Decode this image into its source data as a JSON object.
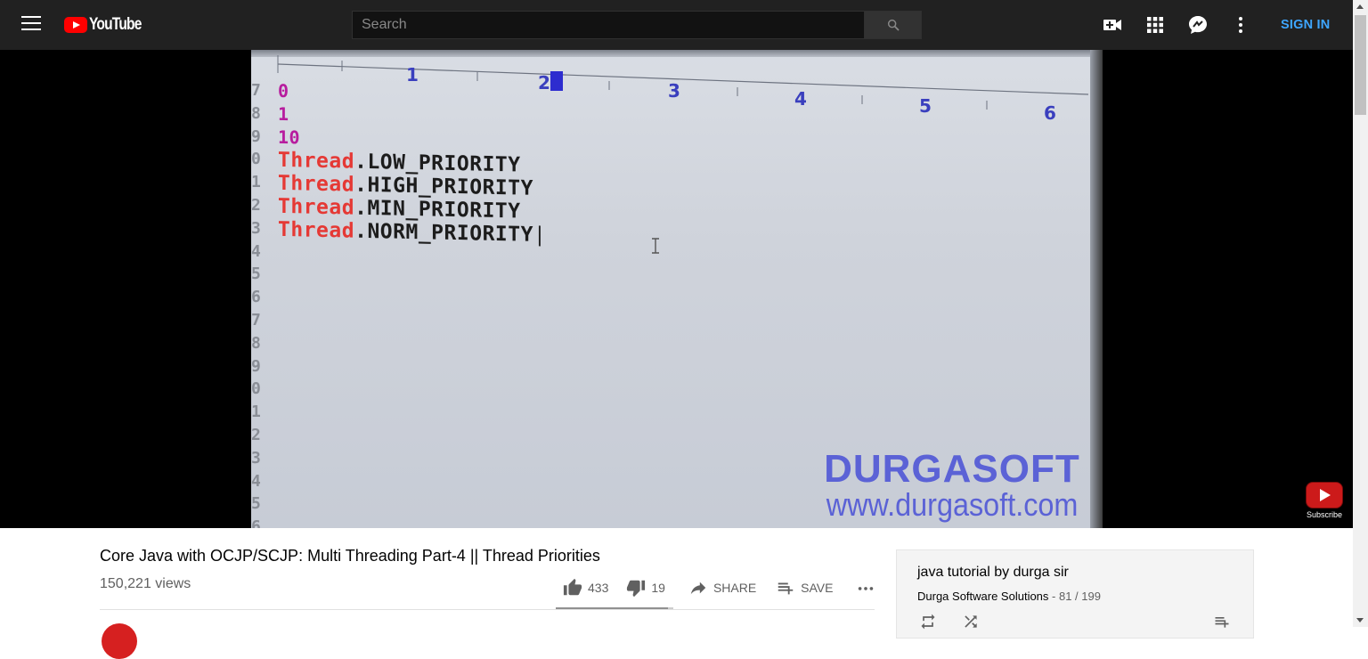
{
  "masthead": {
    "logo_text": "YouTube",
    "search_placeholder": "Search",
    "sign_in_label": "SIGN IN",
    "icons": [
      "menu-icon",
      "youtube-logo",
      "search-icon",
      "create-video-icon",
      "apps-grid-icon",
      "messages-icon",
      "more-vert-icon"
    ]
  },
  "player": {
    "editor_lines": [
      {
        "kind": "num",
        "text": "0"
      },
      {
        "kind": "num",
        "text": "1"
      },
      {
        "kind": "num",
        "text": "10"
      },
      {
        "kind": "code",
        "keyword": "Thread",
        "rest": ".LOW_PRIORITY"
      },
      {
        "kind": "code",
        "keyword": "Thread",
        "rest": ".HIGH_PRIORITY"
      },
      {
        "kind": "code",
        "keyword": "Thread",
        "rest": ".MIN_PRIORITY"
      },
      {
        "kind": "code",
        "keyword": "Thread",
        "rest": ".NORM_PRIORITY"
      }
    ],
    "ruler_numbers": [
      "1",
      "2",
      "3",
      "4",
      "5",
      "6"
    ],
    "watermark_title": "DURGASOFT",
    "watermark_url": "www.durgasoft.com",
    "subscribe_label": "Subscribe"
  },
  "video": {
    "title": "Core Java with OCJP/SCJP: Multi Threading Part-4 || Thread Priorities",
    "views": "150,221 views",
    "likes": "433",
    "dislikes": "19",
    "share_label": "SHARE",
    "save_label": "SAVE",
    "like_ratio": 0.958
  },
  "playlist": {
    "title": "java tutorial by durga sir",
    "owner": "Durga Software Solutions",
    "separator": " - ",
    "position": "81 / 199"
  },
  "colors": {
    "masthead_bg": "#212121",
    "sign_in": "#3ea6ff",
    "logo_red": "#ff0000",
    "keyword_red": "#e53935",
    "watermark_blue": "#5b62d6"
  }
}
